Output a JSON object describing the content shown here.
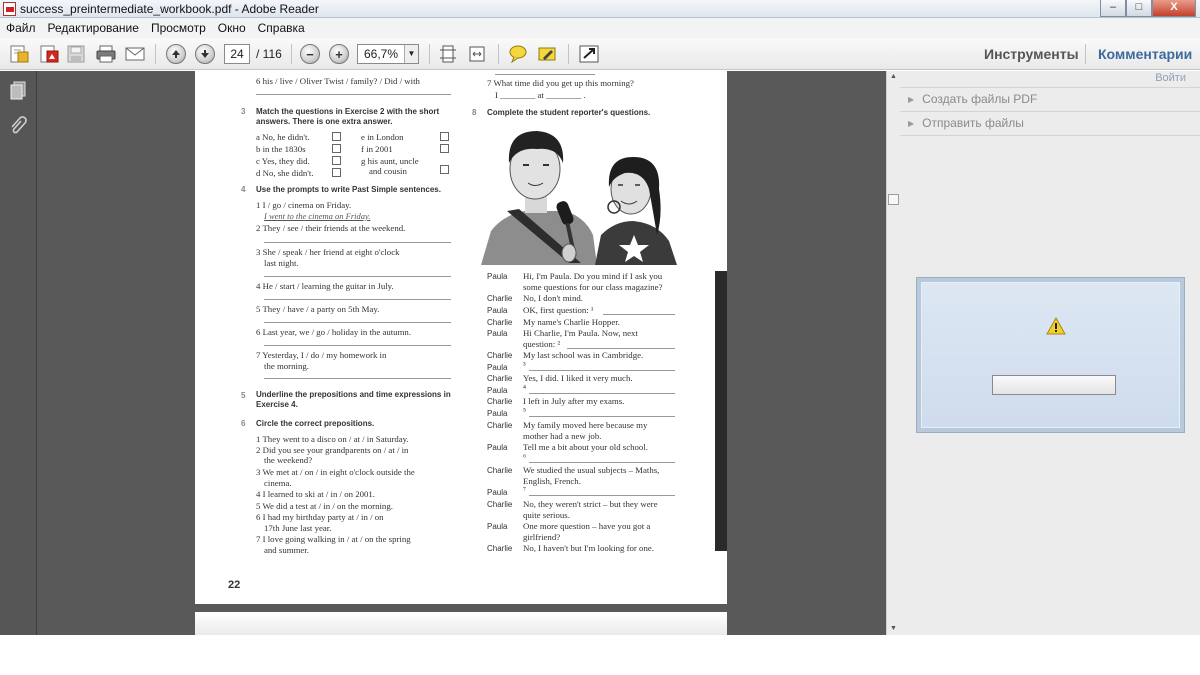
{
  "window": {
    "title": "success_preintermediate_workbook.pdf - Adobe Reader",
    "controls": {
      "minimize": "–",
      "maximize": "□",
      "close": "X"
    }
  },
  "menu": [
    "Файл",
    "Редактирование",
    "Просмотр",
    "Окно",
    "Справка"
  ],
  "toolbar": {
    "current_page": "24",
    "total_pages": "/ 116",
    "zoom": "66,7%",
    "zoom_out_glyph": "−",
    "zoom_in_glyph": "+",
    "tools_tab": "Инструменты",
    "comments_tab": "Комментарии"
  },
  "right_panel": {
    "signin": "Войти",
    "items": [
      "Создать файлы PDF",
      "Отправить файлы"
    ]
  },
  "pdf": {
    "left": {
      "ex2_last": "6 his / live / Oliver Twist / family? / Did / with",
      "ex3_num": "3",
      "ex3_title1": "Match the questions in Exercise 2 with the short",
      "ex3_title2": "answers. There is one extra answer.",
      "ex3_a": "a No, he didn't.",
      "ex3_b": "b in the 1830s",
      "ex3_c": "c Yes, they did.",
      "ex3_d": "d No, she didn't.",
      "ex3_e": "e in London",
      "ex3_f": "f in 2001",
      "ex3_g1": "g his aunt, uncle",
      "ex3_g2": "and cousin",
      "ex4_num": "4",
      "ex4_title": "Use the prompts to write Past Simple sentences.",
      "ex4_1": "1 I / go / cinema on Friday.",
      "ex4_1_answer": "I went to the cinema on Friday.",
      "ex4_2": "2 They / see / their friends at the weekend.",
      "ex4_3a": "3 She / speak / her friend at eight o'clock",
      "ex4_3b": "last night.",
      "ex4_4": "4 He / start / learning the guitar in July.",
      "ex4_5": "5 They / have / a party on 5th May.",
      "ex4_6": "6 Last year, we / go / holiday in the autumn.",
      "ex4_7a": "7 Yesterday, I  / do / my homework in",
      "ex4_7b": "the morning.",
      "ex5_num": "5",
      "ex5_title1": "Underline the prepositions and time expressions in",
      "ex5_title2": "Exercise 4.",
      "ex6_num": "6",
      "ex6_title": "Circle the correct prepositions.",
      "ex6_1": "1 They went to a disco on / at / in Saturday.",
      "ex6_2a": "2 Did you see your grandparents on / at / in",
      "ex6_2b": "the weekend?",
      "ex6_3a": "3 We met at / on / in eight o'clock outside the",
      "ex6_3b": "cinema.",
      "ex6_4": "4 I learned to ski at / in / on 2001.",
      "ex6_5": "5 We did a test at / in / on the morning.",
      "ex6_6a": "6 I had my birthday party at / in / on",
      "ex6_6b": "17th June last year.",
      "ex6_7a": "7 I love going walking in / at / on the spring",
      "ex6_7b": "and summer.",
      "page_number": "22"
    },
    "right": {
      "ex7_7": "7 What time did you get up this morning?",
      "ex7_7_ans": "I ________ at ________ .",
      "ex8_num": "8",
      "ex8_title": "Complete the student reporter's questions.",
      "dialogue": [
        {
          "speaker": "Paula",
          "l1": "Hi, I'm Paula. Do you mind if I ask you",
          "l2": "some questions for our class magazine?"
        },
        {
          "speaker": "Charlie",
          "l1": "No, I don't mind.",
          "l2": ""
        },
        {
          "speaker": "Paula",
          "l1": "OK, first question: ¹",
          "l2": ""
        },
        {
          "speaker": "Charlie",
          "l1": "My name's Charlie Hopper.",
          "l2": ""
        },
        {
          "speaker": "Paula",
          "l1": "Hi Charlie, I'm Paula. Now, next",
          "l2": "question: ²"
        },
        {
          "speaker": "Charlie",
          "l1": "My last school was in Cambridge.",
          "l2": ""
        },
        {
          "speaker": "Paula",
          "l1": "³",
          "l2": ""
        },
        {
          "speaker": "Charlie",
          "l1": "Yes, I did. I liked it very much.",
          "l2": ""
        },
        {
          "speaker": "Paula",
          "l1": "⁴",
          "l2": ""
        },
        {
          "speaker": "Charlie",
          "l1": "I left in July after my exams.",
          "l2": ""
        },
        {
          "speaker": "Paula",
          "l1": "⁵",
          "l2": ""
        },
        {
          "speaker": "Charlie",
          "l1": "My family moved here because my",
          "l2": "mother had a new job."
        },
        {
          "speaker": "Paula",
          "l1": "Tell me a bit about your old school.",
          "l2": "⁶"
        },
        {
          "speaker": "Charlie",
          "l1": "We studied the usual subjects – Maths,",
          "l2": "English, French."
        },
        {
          "speaker": "Paula",
          "l1": "⁷",
          "l2": ""
        },
        {
          "speaker": "Charlie",
          "l1": "No, they weren't strict – but they were",
          "l2": "quite serious."
        },
        {
          "speaker": "Paula",
          "l1": "One more question – have you got a",
          "l2": "girlfriend?"
        },
        {
          "speaker": "Charlie",
          "l1": "No, I haven't but I'm looking for one.",
          "l2": ""
        }
      ]
    }
  }
}
